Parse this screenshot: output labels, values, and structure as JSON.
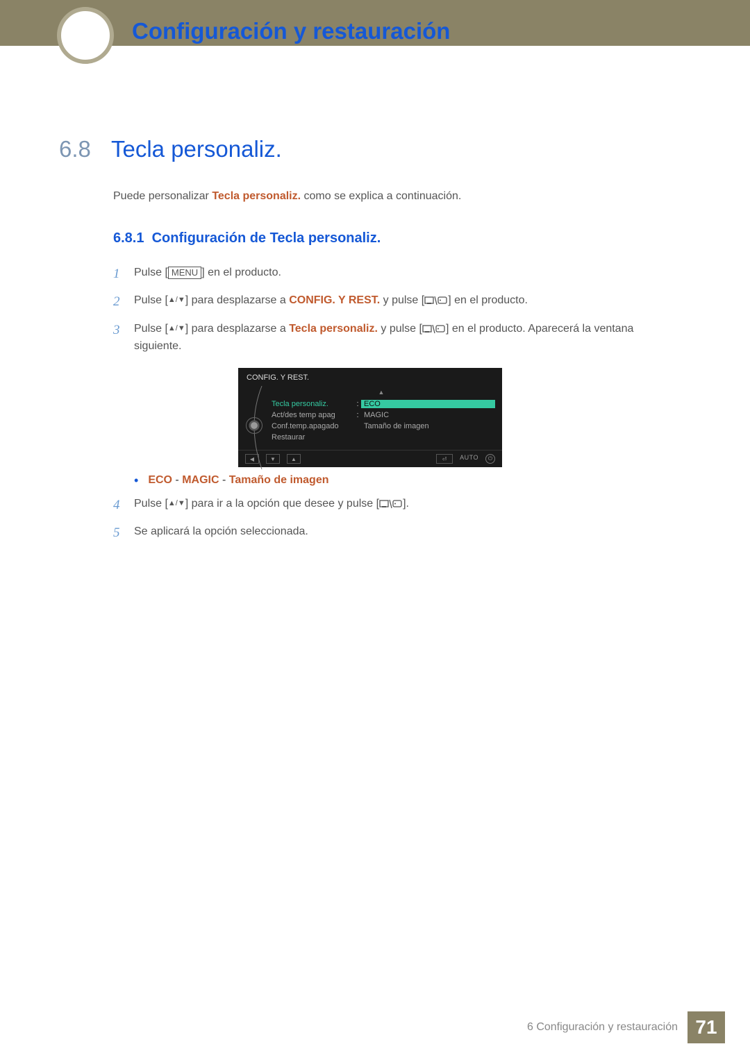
{
  "header": {
    "chapter_title": "Configuración y restauración"
  },
  "section": {
    "number": "6.8",
    "title": "Tecla personaliz."
  },
  "intro": {
    "prefix": "Puede personalizar ",
    "bold": "Tecla personaliz.",
    "suffix": " como se explica a continuación."
  },
  "subsection": {
    "number": "6.8.1",
    "title": "Configuración de Tecla personaliz."
  },
  "steps": {
    "s1": {
      "num": "1",
      "t1": "Pulse [",
      "menu": "MENU",
      "t2": "] en el producto."
    },
    "s2": {
      "num": "2",
      "t1": "Pulse [",
      "arrows": "▲/▼",
      "t2": "] para desplazarse a ",
      "bold": "CONFIG. Y REST.",
      "t3": " y pulse [",
      "t4": "] en el producto."
    },
    "s3": {
      "num": "3",
      "t1": "Pulse [",
      "arrows": "▲/▼",
      "t2": "] para desplazarse a ",
      "bold": "Tecla personaliz.",
      "t3": " y pulse [",
      "t4": "] en el producto. Aparecerá la ventana siguiente."
    },
    "s4": {
      "num": "4",
      "t1": "Pulse [",
      "arrows": "▲/▼",
      "t2": "] para ir a la opción que desee y pulse [",
      "t3": "]."
    },
    "s5": {
      "num": "5",
      "text": "Se aplicará la opción seleccionada."
    }
  },
  "options": {
    "o1": "ECO",
    "sep": " - ",
    "o2": "MAGIC",
    "o3": "Tamaño de imagen"
  },
  "osd": {
    "title": "CONFIG. Y REST.",
    "row1_label": "Tecla personaliz.",
    "row1_value": "ECO",
    "row2_label": "Act/des temp apag",
    "row2_value": "MAGIC",
    "row3_label": "Conf.temp.apagado",
    "row3_value": "Tamaño de imagen",
    "row4_label": "Restaurar",
    "nav_auto": "AUTO"
  },
  "footer": {
    "text": "6 Configuración y restauración",
    "page": "71"
  }
}
